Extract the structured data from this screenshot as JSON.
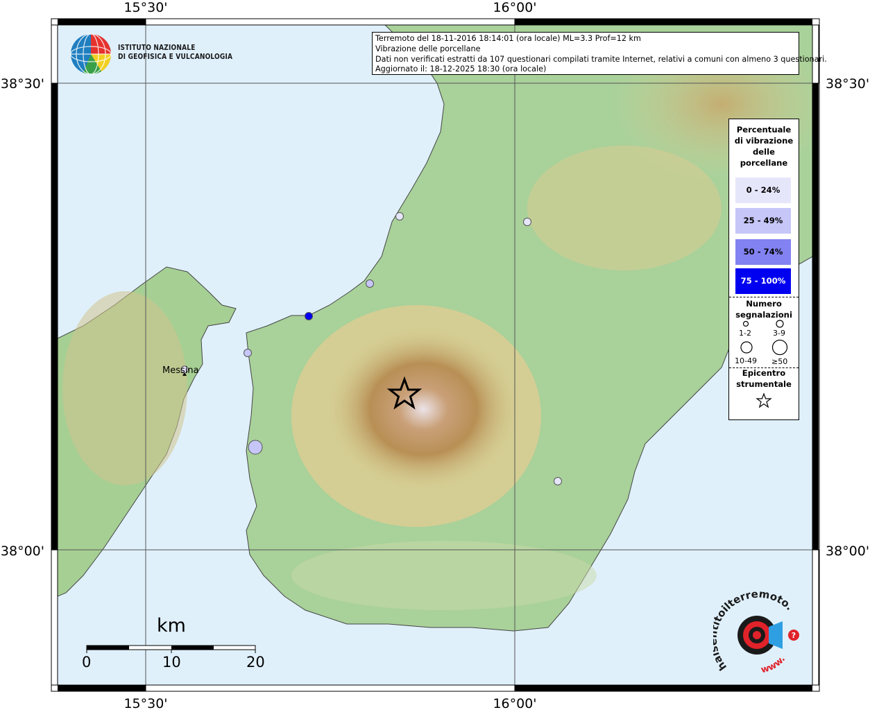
{
  "header": {
    "line1": "Terremoto del 18-11-2016 18:14:01 (ora locale) ML=3.3 Prof=12 km",
    "line2": "Vibrazione delle porcellane",
    "line3": "Dati non verificati estratti da 107 questionari compilati tramite Internet, relativi a comuni con almeno 3 questionari.",
    "line4": "Aggiornato il: 18-12-2025 18:30 (ora locale)"
  },
  "logo": {
    "line1": "ISTITUTO NAZIONALE",
    "line2": "DI GEOFISICA E VULCANOLOGIA"
  },
  "axes": {
    "lon_left": "15°30'",
    "lon_right": "16°00'",
    "lat_top": "38°30'",
    "lat_bottom": "38°00'"
  },
  "legend": {
    "title": "Percentuale di vibrazione delle porcellane",
    "classes": [
      {
        "label": "0 - 24%",
        "color": "#e6e6fb"
      },
      {
        "label": "25 - 49%",
        "color": "#c6c6f8"
      },
      {
        "label": "50 - 74%",
        "color": "#8282f2"
      },
      {
        "label": "75 - 100%",
        "color": "#0000f0"
      }
    ],
    "count_title": "Numero segnalazioni",
    "count_classes": [
      "1-2",
      "3-9",
      "10-49",
      "≥50"
    ],
    "epicenter_title": "Epicentro strumentale"
  },
  "scalebar": {
    "unit": "km",
    "ticks": [
      "0",
      "10",
      "20"
    ]
  },
  "places": {
    "messina": "Messina"
  },
  "epicenter": {
    "lon": 15.92,
    "lat": 38.14
  },
  "reports": [
    {
      "class": 0,
      "size": "3-9"
    },
    {
      "class": 0,
      "size": "3-9"
    },
    {
      "class": 1,
      "size": "3-9"
    },
    {
      "class": 3,
      "size": "3-9"
    },
    {
      "class": 1,
      "size": "3-9"
    },
    {
      "class": 0,
      "size": "3-9"
    },
    {
      "class": 1,
      "size": "10-49"
    },
    {
      "class": 0,
      "size": "3-9"
    },
    {
      "class": 0,
      "size": "3-9"
    }
  ],
  "watermark": {
    "text_a": "haisentitoilterremoto.it",
    "text_b": "www."
  }
}
